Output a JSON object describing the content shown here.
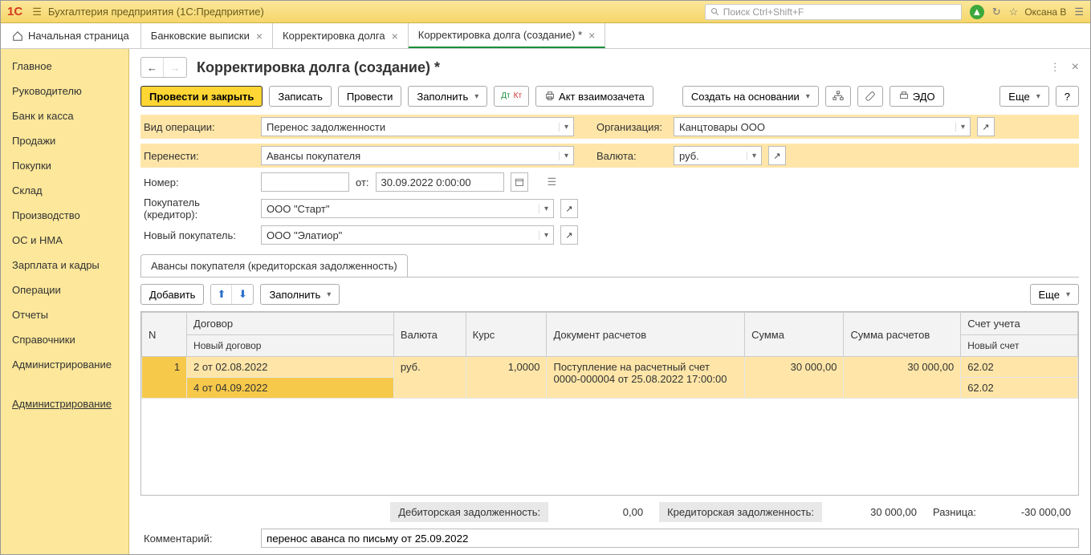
{
  "titlebar": {
    "app_title": "Бухгалтерия предприятия  (1С:Предприятие)",
    "search_placeholder": "Поиск Ctrl+Shift+F",
    "user": "Оксана В"
  },
  "tabs": {
    "home": "Начальная страница",
    "items": [
      {
        "label": "Банковские выписки"
      },
      {
        "label": "Корректировка долга"
      },
      {
        "label": "Корректировка долга (создание) *",
        "active": true
      }
    ]
  },
  "sidebar": {
    "items": [
      "Главное",
      "Руководителю",
      "Банк и касса",
      "Продажи",
      "Покупки",
      "Склад",
      "Производство",
      "ОС и НМА",
      "Зарплата и кадры",
      "Операции",
      "Отчеты",
      "Справочники",
      "Администрирование"
    ],
    "extra": "Администрирование"
  },
  "page": {
    "title": "Корректировка долга (создание) *"
  },
  "toolbar": {
    "post_close": "Провести и закрыть",
    "write": "Записать",
    "post": "Провести",
    "fill": "Заполнить",
    "act": "Акт взаимозачета",
    "create_based": "Создать на основании",
    "edo": "ЭДО",
    "more": "Еще",
    "help": "?"
  },
  "form": {
    "op_type_lbl": "Вид операции:",
    "op_type": "Перенос задолженности",
    "org_lbl": "Организация:",
    "org": "Канцтовары ООО",
    "move_lbl": "Перенести:",
    "move": "Авансы покупателя",
    "currency_lbl": "Валюта:",
    "currency": "руб.",
    "number_lbl": "Номер:",
    "number": "",
    "from_lbl": "от:",
    "date": "30.09.2022  0:00:00",
    "buyer_lbl": "Покупатель (кредитор):",
    "buyer": "ООО \"Старт\"",
    "new_buyer_lbl": "Новый покупатель:",
    "new_buyer": "ООО \"Элатиор\""
  },
  "subtab": {
    "label": "Авансы покупателя (кредиторская задолженность)"
  },
  "subtoolbar": {
    "add": "Добавить",
    "fill": "Заполнить",
    "more": "Еще"
  },
  "table": {
    "headers": {
      "n": "N",
      "contract": "Договор",
      "new_contract": "Новый договор",
      "currency": "Валюта",
      "rate": "Курс",
      "doc": "Документ расчетов",
      "sum": "Сумма",
      "sum_calc": "Сумма расчетов",
      "account": "Счет учета",
      "new_account": "Новый счет"
    },
    "rows": [
      {
        "n": "1",
        "contract": "2 от 02.08.2022",
        "new_contract": "4 от 04.09.2022",
        "currency": "руб.",
        "rate": "1,0000",
        "doc": "Поступление на расчетный счет 0000-000004 от 25.08.2022 17:00:00",
        "sum": "30 000,00",
        "sum_calc": "30 000,00",
        "account": "62.02",
        "new_account": "62.02"
      }
    ]
  },
  "totals": {
    "deb_lbl": "Дебиторская задолженность:",
    "deb_val": "0,00",
    "cred_lbl": "Кредиторская задолженность:",
    "cred_val": "30 000,00",
    "diff_lbl": "Разница:",
    "diff_val": "-30 000,00"
  },
  "comment": {
    "lbl": "Комментарий:",
    "value": "перенос аванса по письму от 25.09.2022"
  }
}
